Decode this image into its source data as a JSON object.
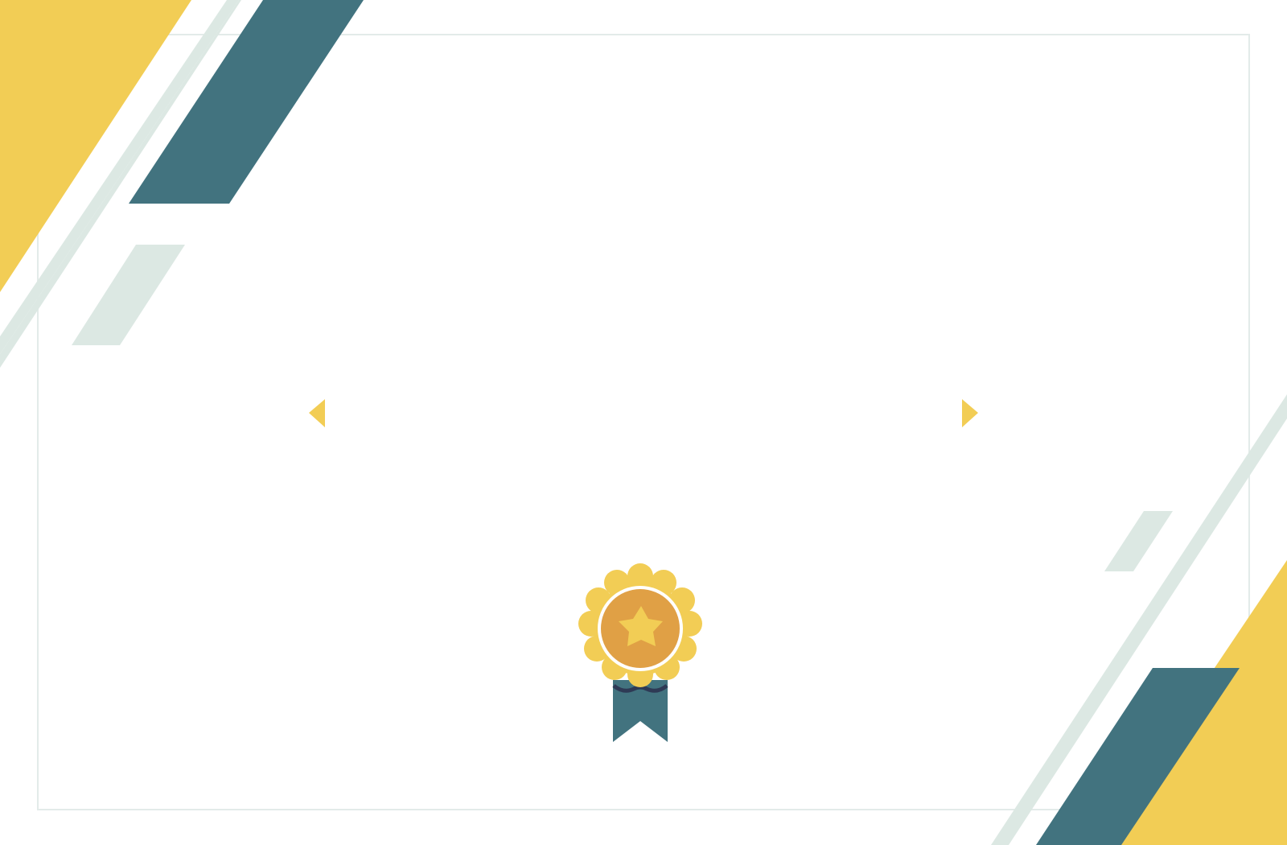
{
  "certificate": {
    "theme": {
      "yellow": "#F2CD55",
      "teal": "#42737F",
      "mint": "#DCE8E3",
      "border": "#E3EBE9",
      "medal_inner": "#E0A045",
      "ribbon_shadow": "#2E3A55",
      "background": "#FFFFFF"
    },
    "icons": {
      "medal": "award-medal-icon",
      "star": "star-icon",
      "left_arrow": "caret-left-icon",
      "right_arrow": "caret-right-icon"
    }
  }
}
